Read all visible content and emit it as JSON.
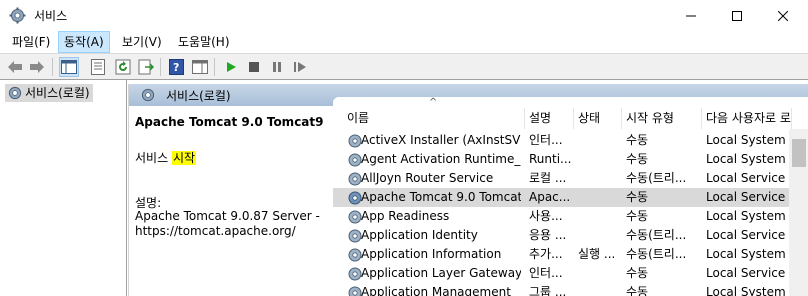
{
  "window": {
    "title": "서비스",
    "minimize_glyph": "—",
    "maximize_glyph": "☐",
    "close_glyph": "✕"
  },
  "menu": [
    {
      "label": "파일(F)",
      "active": false
    },
    {
      "label": "동작(A)",
      "active": true
    },
    {
      "label": "보기(V)",
      "active": false
    },
    {
      "label": "도움말(H)",
      "active": false
    }
  ],
  "toolbar": {
    "icons": [
      "back-icon",
      "forward-icon",
      "show-hide-console-tree-icon",
      "properties-icon",
      "refresh-icon",
      "export-list-icon",
      "help-icon",
      "show-action-pane-icon",
      "start-service-icon",
      "stop-service-icon",
      "pause-service-icon",
      "restart-service-icon"
    ]
  },
  "tree": {
    "selected_label": "서비스(로컬)"
  },
  "header": {
    "title": "서비스(로컬)"
  },
  "details": {
    "service_name": "Apache Tomcat 9.0 Tomcat9",
    "action_prefix": "서비스 ",
    "action_link": "시작",
    "description_label": "설명:",
    "description_text": "Apache Tomcat 9.0.87 Server - https://tomcat.apache.org/"
  },
  "list": {
    "columns": [
      "이름",
      "설명",
      "상태",
      "시작 유형",
      "다음 사용자로 로그온"
    ],
    "sort_glyph": "^",
    "rows": [
      {
        "name": "ActiveX Installer (AxInstSV)",
        "description": "인터...",
        "status": "",
        "startup": "수동",
        "logon": "Local System",
        "selected": false
      },
      {
        "name": "Agent Activation Runtime_...",
        "description": "Runti...",
        "status": "",
        "startup": "수동",
        "logon": "Local System",
        "selected": false
      },
      {
        "name": "AllJoyn Router Service",
        "description": "로컬 ...",
        "status": "",
        "startup": "수동(트리...",
        "logon": "Local Service",
        "selected": false
      },
      {
        "name": "Apache Tomcat 9.0 Tomcat9",
        "description": "Apac...",
        "status": "",
        "startup": "수동",
        "logon": "Local Service",
        "selected": true
      },
      {
        "name": "App Readiness",
        "description": "사용...",
        "status": "",
        "startup": "수동",
        "logon": "Local System",
        "selected": false
      },
      {
        "name": "Application Identity",
        "description": "응용 ...",
        "status": "",
        "startup": "수동(트리...",
        "logon": "Local Service",
        "selected": false
      },
      {
        "name": "Application Information",
        "description": "추가...",
        "status": "실행 ...",
        "startup": "수동(트리...",
        "logon": "Local System",
        "selected": false
      },
      {
        "name": "Application Layer Gateway ...",
        "description": "인터...",
        "status": "",
        "startup": "수동",
        "logon": "Local Service",
        "selected": false
      },
      {
        "name": "Application Management",
        "description": "그룹 ...",
        "status": "",
        "startup": "수동",
        "logon": "Local System",
        "selected": false
      }
    ]
  }
}
